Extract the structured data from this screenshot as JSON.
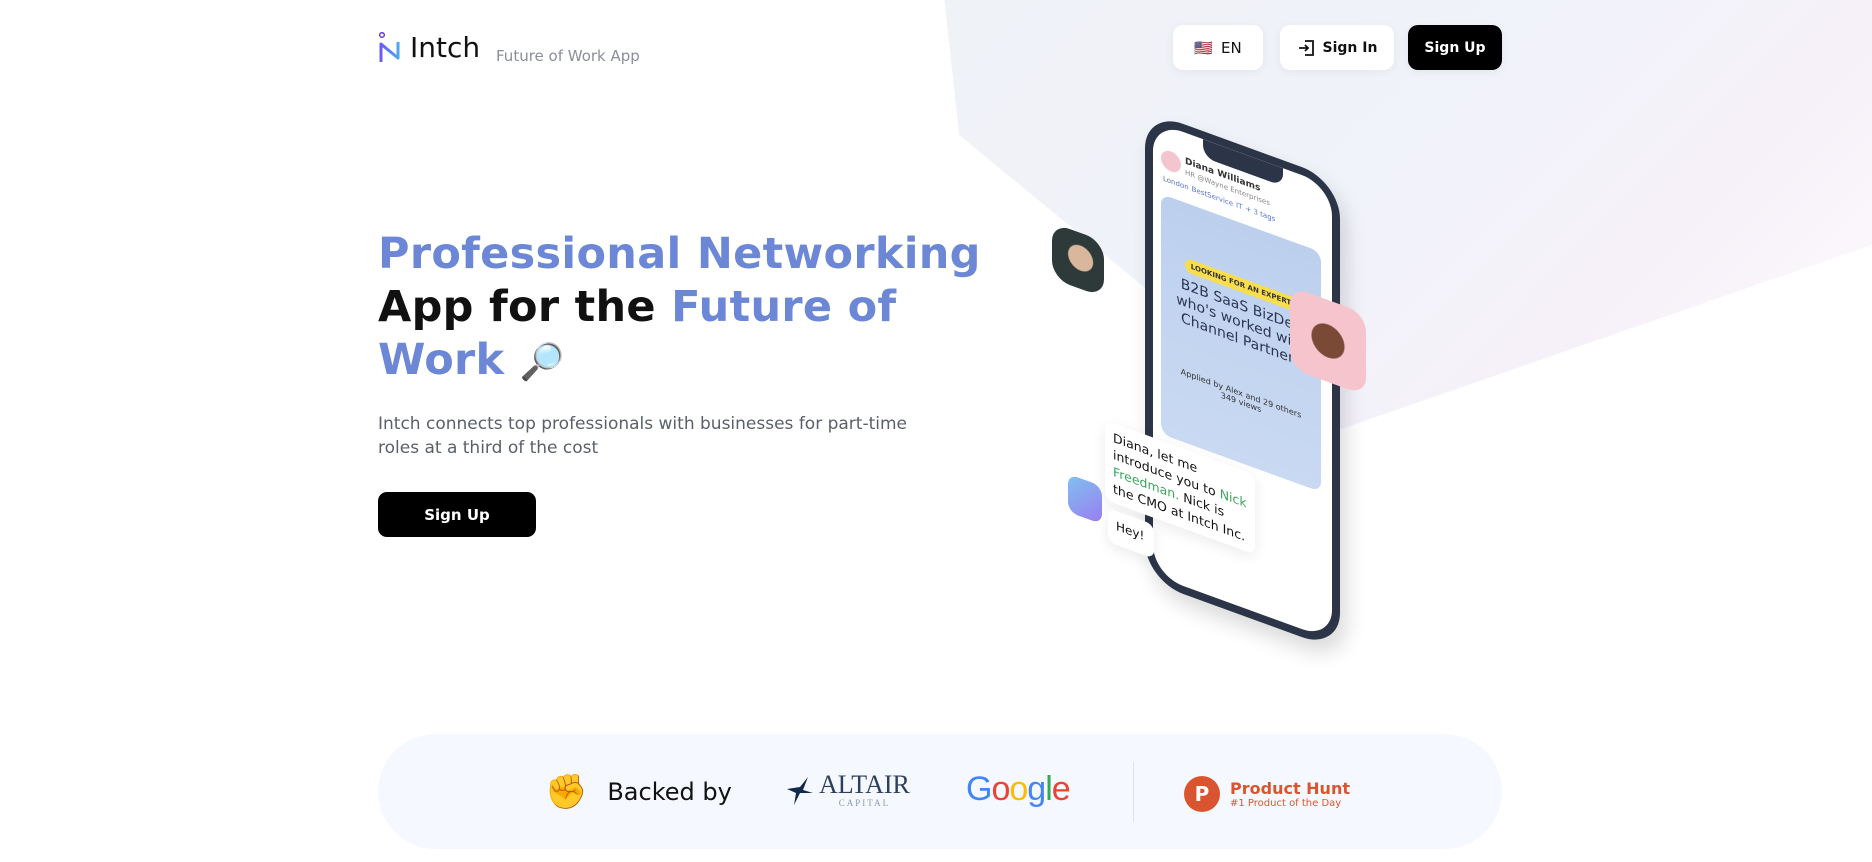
{
  "header": {
    "brand": "Intch",
    "tagline": "Future of Work App",
    "language": "EN",
    "sign_in": "Sign In",
    "sign_up": "Sign Up"
  },
  "hero": {
    "title_part1": "Professional Networking",
    "title_part2": "App for the ",
    "title_part3": "Future of",
    "title_part4": "Work",
    "title_emoji": "🔎",
    "description": "Intch connects top professionals with businesses for part-time roles at a third of the cost",
    "cta": "Sign Up",
    "accent_color": "#6c87d6"
  },
  "phone": {
    "name": "Diana Williams",
    "role": "HR @Wayne Enterprises",
    "tags": [
      "London",
      "BestService",
      "IT",
      "+ 3 tags"
    ],
    "badge": "LOOKING FOR AN EXPERT",
    "job": "B2B SaaS BizDev who's worked with Channel Partners",
    "applied": "Applied by Alex and 29 others",
    "views": "349 views",
    "chat_1": "Diana, let me introduce you to",
    "chat_name": "Nick Freedman.",
    "chat_2": "Nick is the CMO at Intch Inc.",
    "reply": "Hey!"
  },
  "backers": {
    "emoji": "✊",
    "label": "Backed by",
    "altair": "ALTAIR",
    "altair_sub": "CAPITAL",
    "google": "Google",
    "ph_title": "Product Hunt",
    "ph_sub": "#1 Product of the Day",
    "ph_letter": "P"
  }
}
